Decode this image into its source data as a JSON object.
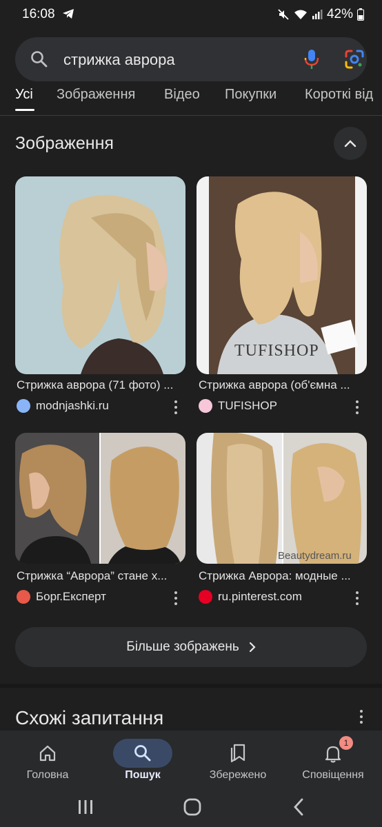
{
  "status_bar": {
    "time": "16:08",
    "battery": "42%"
  },
  "search": {
    "query": "стрижка аврора"
  },
  "tabs": [
    {
      "label": "Усі"
    },
    {
      "label": "Зображення"
    },
    {
      "label": "Відео"
    },
    {
      "label": "Покупки"
    },
    {
      "label": "Короткі від"
    }
  ],
  "images_section": {
    "title": "Зображення",
    "results": [
      {
        "caption": "Стрижка аврора (71 фото) ...",
        "source": "modnjashki.ru"
      },
      {
        "caption": "Стрижка аврора (об'ємна ...",
        "source": "TUFISHOP",
        "watermark": "TUFISHOP"
      },
      {
        "caption": "Стрижка “Аврора” стане х...",
        "source": "Борг.Експерт"
      },
      {
        "caption": "Стрижка Аврора: модные ...",
        "source": "ru.pinterest.com",
        "watermark": "Beautydream.ru"
      }
    ],
    "more_label": "Більше зображень"
  },
  "related": {
    "title": "Схожі запитання"
  },
  "bottom_nav": {
    "items": [
      {
        "label": "Головна",
        "icon": "home-icon"
      },
      {
        "label": "Пошук",
        "icon": "search-icon"
      },
      {
        "label": "Збережено",
        "icon": "bookmarks-icon"
      },
      {
        "label": "Сповіщення",
        "icon": "bell-icon",
        "badge": "1"
      }
    ]
  },
  "colors": {
    "background": "#1f1f1f",
    "surface": "#303134",
    "active_tab_pill": "#3a4a66"
  }
}
